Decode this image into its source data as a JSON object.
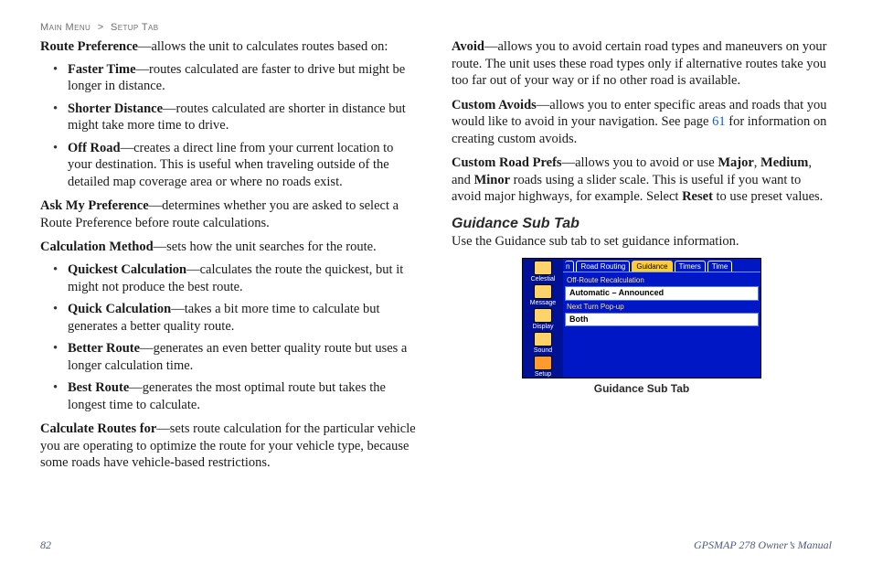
{
  "breadcrumb": {
    "a": "Main Menu",
    "sep": ">",
    "b": "Setup Tab"
  },
  "left": {
    "routePref": {
      "term": "Route Preference",
      "desc": "—allows the unit to calculates routes based on:"
    },
    "rp_items": [
      {
        "term": "Faster Time",
        "desc": "—routes calculated are faster to drive but might be longer in distance."
      },
      {
        "term": "Shorter Distance",
        "desc": "—routes calculated are shorter in distance but might take more time to drive."
      },
      {
        "term": "Off Road",
        "desc": "—creates a direct line from your current location to your destination. This is useful when  traveling outside of the detailed map coverage area or where no roads exist."
      }
    ],
    "askPref": {
      "term": "Ask My Preference",
      "desc": "—determines whether you are asked to select a Route Preference before route calculations."
    },
    "calcMethod": {
      "term": "Calculation Method",
      "desc": "—sets how the unit searches for the route."
    },
    "cm_items": [
      {
        "term": "Quickest Calculation",
        "desc": "—calculates the route the quickest, but it might not produce the best route."
      },
      {
        "term": "Quick Calculation",
        "desc": "—takes a bit more time to calculate but generates a better quality route."
      },
      {
        "term": "Better Route",
        "desc": "—generates an even better quality route but uses a longer calculation time."
      },
      {
        "term": "Best Route",
        "desc": "—generates the most optimal route but takes the longest time to calculate."
      }
    ],
    "calcFor": {
      "term": "Calculate Routes for",
      "desc": "—sets route calculation for the particular vehicle you are operating to optimize the route for your vehicle type, because some roads have vehicle-based restrictions."
    }
  },
  "right": {
    "avoid": {
      "term": "Avoid",
      "desc": "—allows you to avoid certain road types and maneuvers on your route. The unit uses these road types only if alternative routes take you too far out of your way or if no other road is available."
    },
    "customAvoids": {
      "term": "Custom Avoids",
      "pre": "—allows you to enter specific areas and roads that you would like to avoid in your navigation. See page ",
      "link": "61",
      "post": " for information on creating custom avoids."
    },
    "customRoadPrefs": {
      "term": "Custom Road Prefs",
      "a": "—allows you to avoid or use ",
      "major": "Major",
      "c1": ", ",
      "medium": "Medium",
      "c2": ", and ",
      "minor": "Minor",
      "b": " roads using a slider scale. This is useful if you want to avoid major highways, for example. Select ",
      "reset": "Reset",
      "c": " to use preset values."
    },
    "guidanceHead": "Guidance Sub Tab",
    "guidanceText": "Use the Guidance sub tab to set guidance information.",
    "deviceCaption": "Guidance Sub Tab",
    "device": {
      "sidebar": [
        "Celestial",
        "Message",
        "Display",
        "Sound",
        "Setup"
      ],
      "tabs": {
        "pre": "n",
        "t1": "Road Routing",
        "t2": "Guidance",
        "t3": "Timers",
        "t4": "Time"
      },
      "f1": {
        "label": "Off-Route Recalculation",
        "value": "Automatic – Announced"
      },
      "f2": {
        "label": "Next Turn Pop-up",
        "value": "Both"
      }
    }
  },
  "footer": {
    "page": "82",
    "manual": "GPSMAP 278 Owner’s Manual"
  }
}
